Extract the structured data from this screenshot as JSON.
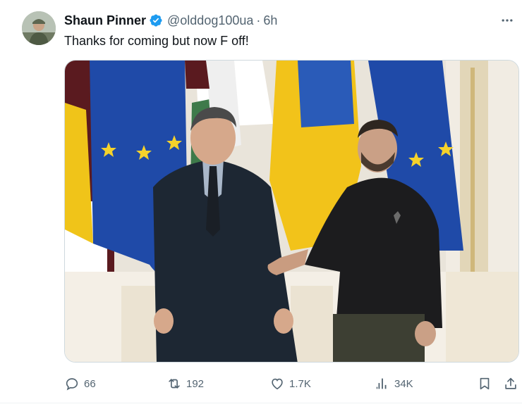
{
  "author": {
    "name": "Shaun Pinner",
    "handle": "@olddog100ua",
    "separator": "·",
    "time": "6h",
    "verified_color": "#1d9bf0"
  },
  "tweet": {
    "text": "Thanks for coming but now F off!"
  },
  "media": {
    "description_icon": "photo"
  },
  "metrics": {
    "replies": "66",
    "reposts": "192",
    "likes": "1.7K",
    "views": "34K"
  },
  "colors": {
    "text": "#0f1419",
    "secondary": "#536471",
    "accent": "#1d9bf0"
  }
}
